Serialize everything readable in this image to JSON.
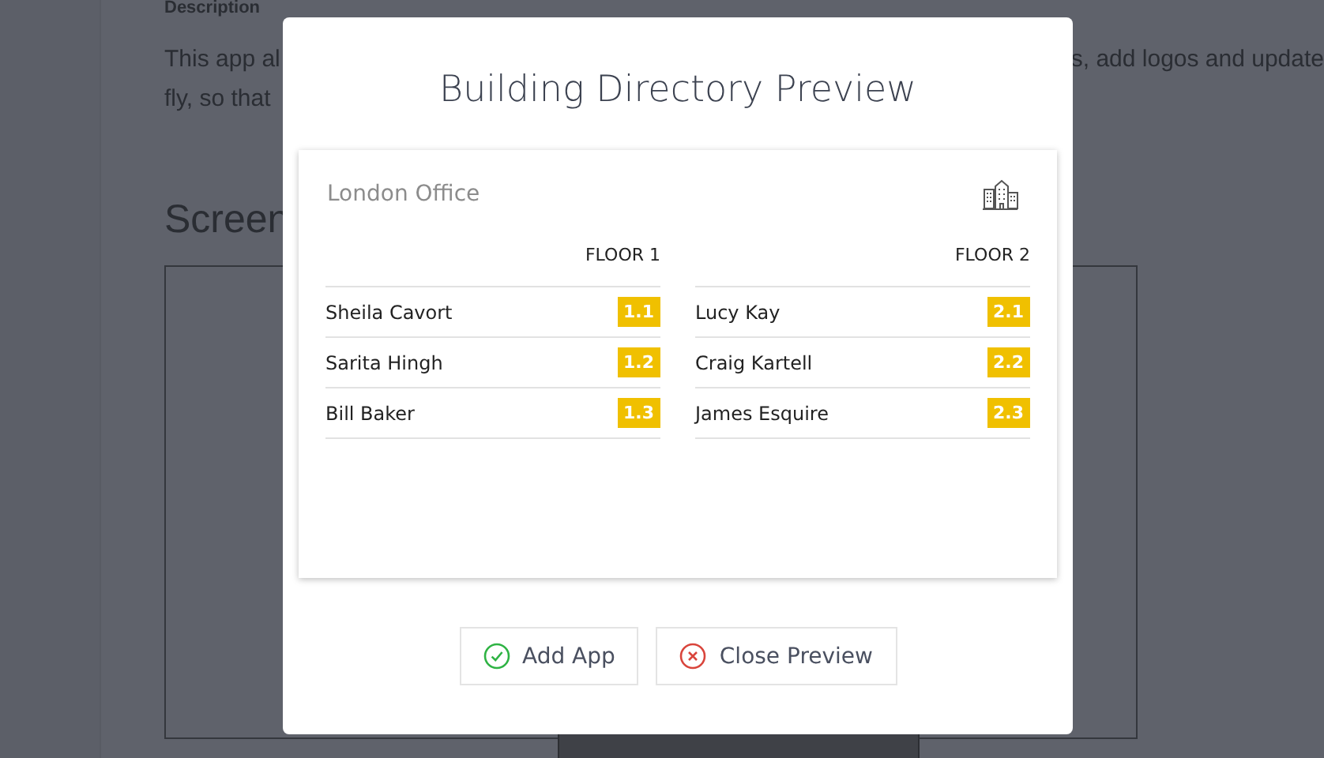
{
  "background": {
    "description_heading": "Description",
    "paragraph_lines": [
      {
        "left": "This app al",
        "right": "s, add logos and update"
      },
      {
        "left": "fly, so that"
      }
    ],
    "screenshots_heading": "Screen"
  },
  "modal": {
    "title": "Building Directory Preview",
    "card": {
      "location": "London Office",
      "floors": [
        {
          "label": "FLOOR 1",
          "entries": [
            {
              "name": "Sheila Cavort",
              "room": "1.1"
            },
            {
              "name": "Sarita Hingh",
              "room": "1.2"
            },
            {
              "name": "Bill Baker",
              "room": "1.3"
            }
          ]
        },
        {
          "label": "FLOOR 2",
          "entries": [
            {
              "name": "Lucy Kay",
              "room": "2.1"
            },
            {
              "name": "Craig Kartell",
              "room": "2.2"
            },
            {
              "name": "James Esquire",
              "room": "2.3"
            }
          ]
        }
      ]
    },
    "buttons": [
      {
        "label": "Add App",
        "kind": "confirm"
      },
      {
        "label": "Close Preview",
        "kind": "cancel"
      }
    ]
  }
}
